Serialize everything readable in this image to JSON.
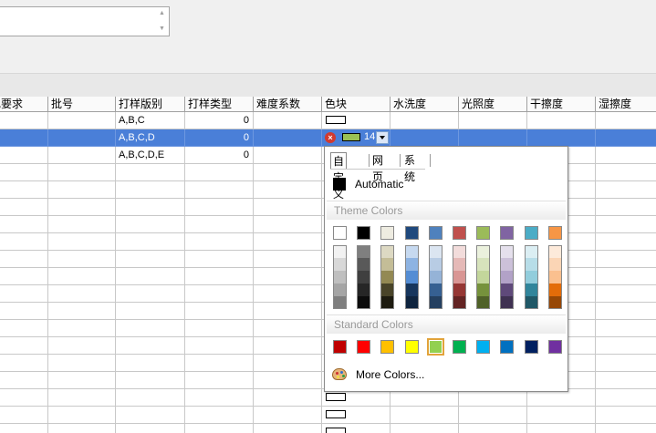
{
  "columns": [
    "色要求",
    "批号",
    "打样版别",
    "打样类型",
    "难度系数",
    "色块",
    "水洗度",
    "光照度",
    "干擦度",
    "湿擦度"
  ],
  "rows": [
    {
      "version": "A,B,C",
      "type": "0"
    },
    {
      "version": "A,B,C,D",
      "type": "0",
      "color_value": "14"
    },
    {
      "version": "A,B,C,D,E",
      "type": "0"
    }
  ],
  "editor": {
    "error_icon": "error-icon",
    "color": "#9ac054",
    "value": "14",
    "dropdown_icon": "chevron-down-icon"
  },
  "popup": {
    "tabs": [
      "自定义",
      "网页",
      "系统"
    ],
    "automatic_label": "Automatic",
    "theme_colors_label": "Theme Colors",
    "standard_colors_label": "Standard Colors",
    "more_colors_label": "More Colors...",
    "more_colors_icon": "palette-icon",
    "theme_top_row": [
      "#ffffff",
      "#000000",
      "#eeece1",
      "#1f497d",
      "#4f81bd",
      "#c0504d",
      "#9bbb59",
      "#8064a2",
      "#4bacc6",
      "#f79646"
    ],
    "theme_shades": [
      [
        "#f2f2f2",
        "#7f7f7f",
        "#ddd9c3",
        "#c6d9f0",
        "#dbe5f1",
        "#f2dcdb",
        "#ebf1dd",
        "#e5e0ec",
        "#dbeef3",
        "#fdeada"
      ],
      [
        "#d8d8d8",
        "#595959",
        "#c4bd97",
        "#8db3e2",
        "#b8cce4",
        "#e5b9b7",
        "#d7e3bc",
        "#ccc1d9",
        "#b7dde8",
        "#fbd5b5"
      ],
      [
        "#bfbfbf",
        "#3f3f3f",
        "#938953",
        "#548dd4",
        "#95b3d7",
        "#d99694",
        "#c3d69b",
        "#b2a2c7",
        "#92cddc",
        "#fac08f"
      ],
      [
        "#a5a5a5",
        "#262626",
        "#494429",
        "#17365d",
        "#366092",
        "#953734",
        "#76923c",
        "#5f497a",
        "#31859b",
        "#e36c09"
      ],
      [
        "#7f7f7f",
        "#0c0c0c",
        "#1d1b10",
        "#0f243e",
        "#244061",
        "#632423",
        "#4f6128",
        "#3f3151",
        "#205867",
        "#974806"
      ]
    ],
    "standard_colors": [
      "#c00000",
      "#ff0000",
      "#ffc000",
      "#ffff00",
      "#92d050",
      "#00b050",
      "#00b0f0",
      "#0070c0",
      "#002060",
      "#7030a0"
    ],
    "selected_standard_index": 4
  }
}
